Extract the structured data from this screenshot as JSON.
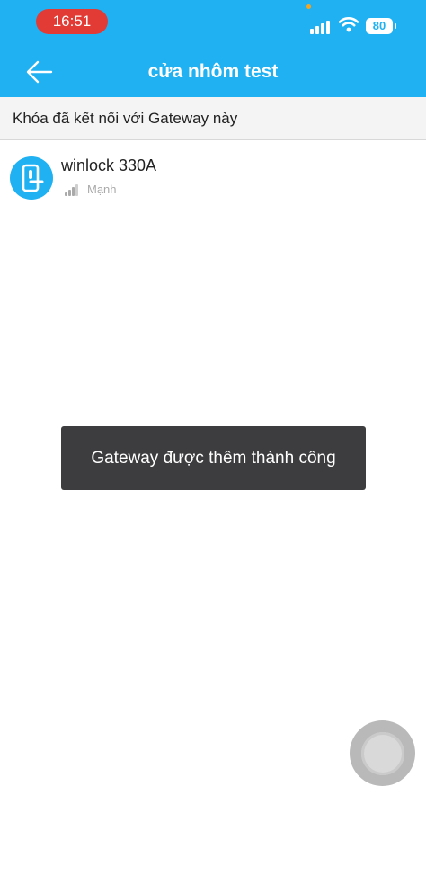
{
  "status_bar": {
    "time": "16:51",
    "battery": "80",
    "icons": [
      "signal-icon",
      "wifi-icon",
      "battery-icon"
    ]
  },
  "header": {
    "title": "cửa nhôm test",
    "back_icon": "arrow-left-icon"
  },
  "section": {
    "title": "Khóa đã kết nối với Gateway này"
  },
  "locks": [
    {
      "name": "winlock 330A",
      "signal": "Mạnh",
      "icon": "door-lock-icon"
    }
  ],
  "toast": {
    "message": "Gateway được thêm thành công"
  },
  "colors": {
    "primary": "#1fb1f2",
    "time_pill": "#e23b35",
    "toast_bg": "#3d3d3f",
    "muted_text": "#aaaaaa"
  }
}
